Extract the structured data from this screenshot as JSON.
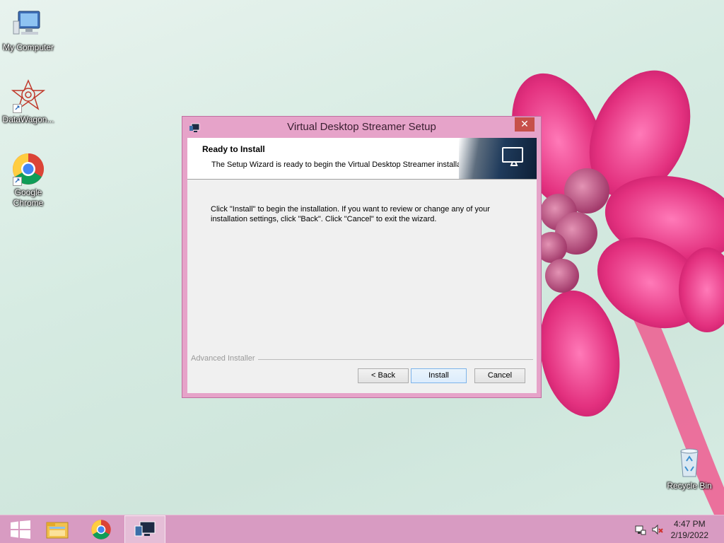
{
  "desktop": {
    "icons": [
      {
        "label": "My Computer",
        "icon": "computer-icon"
      },
      {
        "label": "DataWagon...",
        "icon": "datawagon-icon"
      },
      {
        "label": "Google Chrome",
        "icon": "chrome-icon"
      },
      {
        "label": "Recycle Bin",
        "icon": "recycle-bin-icon"
      }
    ]
  },
  "window": {
    "title": "Virtual Desktop Streamer Setup",
    "close_glyph": "✕",
    "banner": {
      "heading": "Ready to Install",
      "subheading": "The Setup Wizard is ready to begin the Virtual Desktop Streamer installation"
    },
    "body_line1": "Click \"Install\" to begin the installation.  If you want to review or change any of your",
    "body_line2": "installation settings, click \"Back\".  Click \"Cancel\" to exit the wizard.",
    "brand": "Advanced Installer",
    "buttons": {
      "back": "< Back",
      "install": "Install",
      "cancel": "Cancel"
    }
  },
  "taskbar": {
    "items": [
      "start-icon",
      "file-explorer-icon",
      "chrome-icon",
      "virtual-desktop-setup-icon"
    ],
    "clock_time": "4:47 PM",
    "clock_date": "2/19/2022"
  },
  "colors": {
    "window_frame": "#e6a3c9",
    "taskbar": "#d89bc2",
    "close_button": "#c7504a"
  }
}
